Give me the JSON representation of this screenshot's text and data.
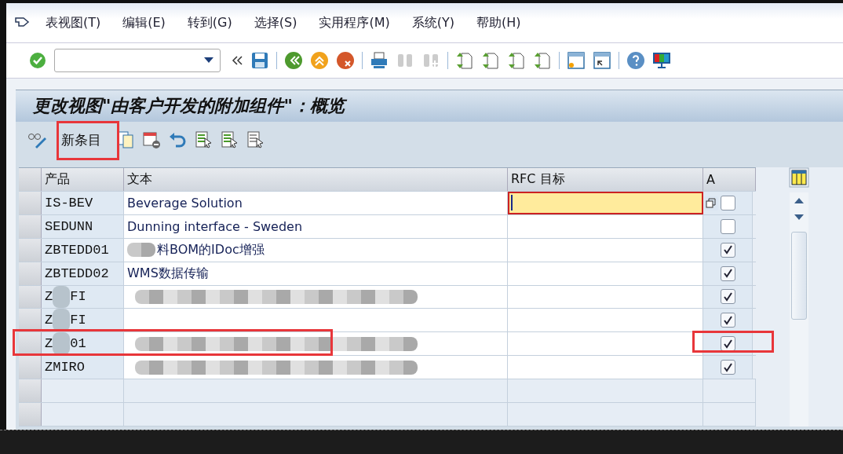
{
  "menu": [
    {
      "label": "表视图(T)"
    },
    {
      "label": "编辑(E)"
    },
    {
      "label": "转到(G)"
    },
    {
      "label": "选择(S)"
    },
    {
      "label": "实用程序(M)"
    },
    {
      "label": "系统(Y)"
    },
    {
      "label": "帮助(H)"
    }
  ],
  "title": "更改视图\"由客户开发的附加组件\"：概览",
  "new_entries_button": "新条目",
  "table": {
    "columns": [
      "产品",
      "文本",
      "RFC 目标",
      "A"
    ],
    "rows": [
      {
        "product": [
          "IS-BEV"
        ],
        "text": "Beverage Solution",
        "text_hidden": false,
        "checked": false,
        "focused": true
      },
      {
        "product": [
          "SEDUNN"
        ],
        "text": "Dunning interface - Sweden",
        "text_hidden": false,
        "checked": false,
        "focused": false
      },
      {
        "product": [
          "ZBTEDD01"
        ],
        "text": "料BOM的IDoc增强",
        "text_hidden": true,
        "checked": true,
        "focused": false
      },
      {
        "product": [
          "ZBTEDD02"
        ],
        "text": "WMS数据传输",
        "text_hidden": false,
        "checked": true,
        "focused": false
      },
      {
        "product": [
          "Z",
          "FI"
        ],
        "text_hidden": true,
        "checked": true,
        "focused": false
      },
      {
        "product": [
          "Z",
          "FI"
        ],
        "text_hidden": false,
        "checked": true,
        "focused": false
      },
      {
        "product": [
          "Z",
          "01"
        ],
        "text_hidden": true,
        "checked": true,
        "focused": false,
        "highlighted": true
      },
      {
        "product": [
          "ZMIRO"
        ],
        "text_hidden": true,
        "checked": true,
        "focused": false
      }
    ]
  }
}
